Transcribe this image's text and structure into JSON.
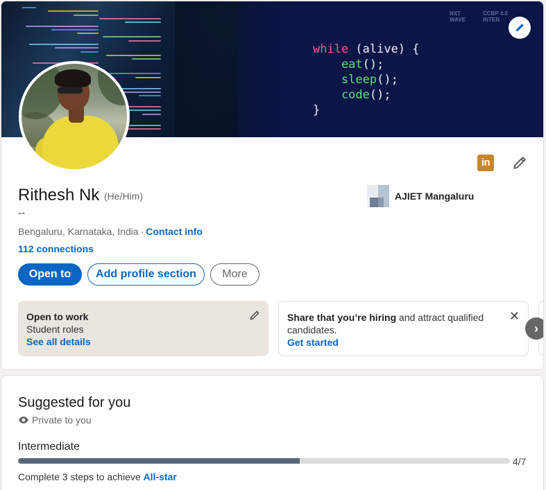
{
  "banner": {
    "code_lines": [
      {
        "parts": [
          {
            "t": "while",
            "c": "kw"
          },
          {
            "t": " (alive) {",
            "c": "pl"
          }
        ]
      },
      {
        "parts": [
          {
            "t": "    eat",
            "c": "fn"
          },
          {
            "t": "();",
            "c": "pl"
          }
        ]
      },
      {
        "parts": [
          {
            "t": "    sleep",
            "c": "fn"
          },
          {
            "t": "();",
            "c": "pl"
          }
        ]
      },
      {
        "parts": [
          {
            "t": "    code",
            "c": "fn"
          },
          {
            "t": "();",
            "c": "pl"
          }
        ]
      },
      {
        "parts": [
          {
            "t": "}",
            "c": "pl"
          }
        ]
      }
    ],
    "brand_1": "NXT\nWAVE",
    "brand_2": "CCBP 4.0\nINTEN"
  },
  "profile": {
    "name": "Rithesh Nk",
    "pronouns": "(He/Him)",
    "headline": "--",
    "location": "Bengaluru, Karnataka, India",
    "contact_label": "Contact info",
    "connections": "112 connections",
    "company": "AJIET Mangaluru",
    "linkedin_badge": "in"
  },
  "actions": {
    "open_to": "Open to",
    "add_section": "Add profile section",
    "more": "More"
  },
  "open_to_work": {
    "title": "Open to work",
    "subtitle": "Student roles",
    "link": "See all details"
  },
  "hiring": {
    "bold": "Share that you’re hiring",
    "rest": " and attract qualified candidates.",
    "link": "Get started",
    "close": "✕"
  },
  "carousel": {
    "next": "›"
  },
  "suggested": {
    "title": "Suggested for you",
    "privacy": "Private to you",
    "level": "Intermediate",
    "progress_count": "4/7",
    "progress_fraction": 0.573,
    "steps_prefix": "Complete 3 steps to achieve ",
    "steps_goal": "All-star"
  },
  "colors": {
    "accent": "#0a66c2",
    "progress_fill": "#56687a",
    "banner_bg": "#0b1547",
    "open_to_work_bg": "#e9e5df"
  }
}
